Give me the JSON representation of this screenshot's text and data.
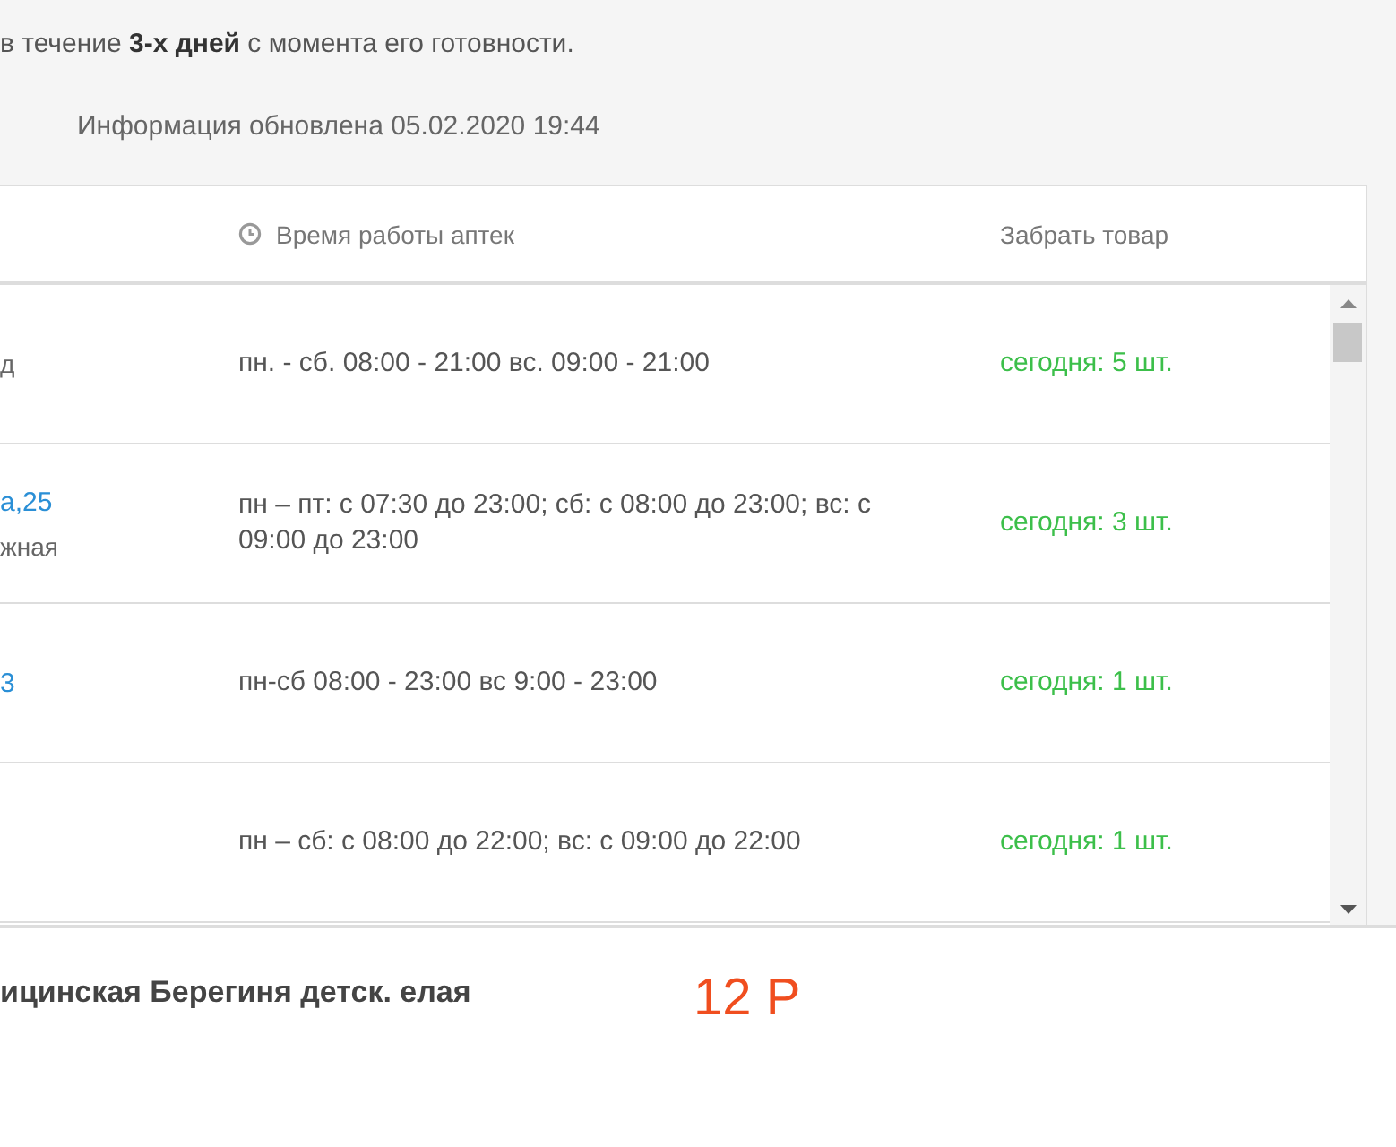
{
  "notice": "в течение **3-х дней** с момента его готовности.",
  "updated": "Информация обновлена 05.02.2020 19:44",
  "table": {
    "columns": [
      "Время работы аптек",
      "Забрать товар"
    ],
    "rows": [
      {
        "address": [
          {
            "kind": "text",
            "text": "д"
          }
        ],
        "hours": "пн. - сб. 08:00 - 21:00 вс. 09:00 - 21:00",
        "pickup": "сегодня: 5 шт."
      },
      {
        "address": [
          {
            "kind": "link",
            "text": "а,25"
          },
          {
            "kind": "text",
            "text": "жная"
          }
        ],
        "hours": "пн – пт: с 07:30 до 23:00; сб: с 08:00 до 23:00; вс: с 09:00 до 23:00",
        "pickup": "сегодня: 3 шт."
      },
      {
        "address": [
          {
            "kind": "link",
            "text": "3"
          }
        ],
        "hours": "пн-сб 08:00 - 23:00 вс 9:00 - 23:00",
        "pickup": "сегодня: 1 шт."
      },
      {
        "hours": "пн – сб: с 08:00 до 22:00; вс: с 09:00 до 22:00",
        "pickup": "сегодня: 1 шт."
      }
    ]
  },
  "product": {
    "name": "ицинская Берегиня детск. елая",
    "price": "12 Р"
  }
}
